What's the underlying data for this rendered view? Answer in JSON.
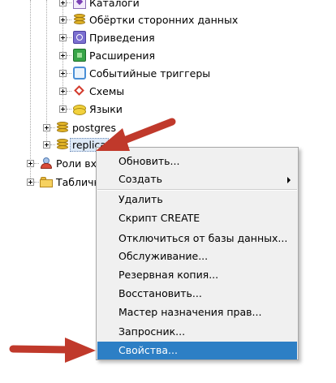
{
  "tree": {
    "items": [
      {
        "label": "Каталоги",
        "icon": "catalog-icon"
      },
      {
        "label": "Обёртки сторонних данных",
        "icon": "fdw-icon"
      },
      {
        "label": "Приведения",
        "icon": "cast-icon"
      },
      {
        "label": "Расширения",
        "icon": "extension-icon"
      },
      {
        "label": "Событийные триггеры",
        "icon": "event-trigger-icon"
      },
      {
        "label": "Схемы",
        "icon": "schema-icon"
      },
      {
        "label": "Языки",
        "icon": "language-icon"
      },
      {
        "label": "postgres",
        "icon": "database-icon"
      },
      {
        "label": "replica",
        "icon": "database-icon"
      },
      {
        "label": "Роли вхо",
        "icon": "login-roles-icon"
      },
      {
        "label": "Табличн",
        "icon": "tablespaces-icon"
      }
    ]
  },
  "context_menu": {
    "items": [
      {
        "label": "Обновить..."
      },
      {
        "label": "Создать",
        "submenu": true
      },
      {
        "label": "Удалить"
      },
      {
        "label": "Скрипт CREATE"
      },
      {
        "label": "Отключиться от базы данных..."
      },
      {
        "label": "Обслуживание..."
      },
      {
        "label": "Резервная копия..."
      },
      {
        "label": "Восстановить..."
      },
      {
        "label": "Мастер назначения прав..."
      },
      {
        "label": "Запросник..."
      },
      {
        "label": "Свойства...",
        "highlighted": true
      }
    ]
  },
  "colors": {
    "highlight": "#2d7fc5",
    "annotation_arrow": "#c0392b"
  }
}
